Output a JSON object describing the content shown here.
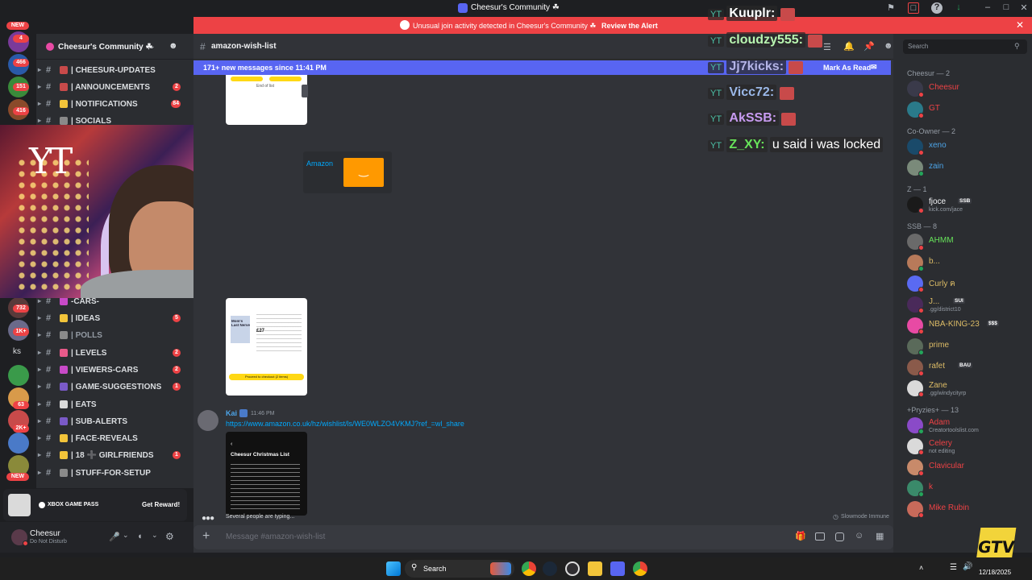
{
  "window": {
    "title": "Cheesur's Community ☘"
  },
  "alert": {
    "text": "Unusual join activity detected in Cheesur's Community ☘",
    "action": "Review the Alert"
  },
  "rail": {
    "new_top": "NEW",
    "new_bottom": "NEW",
    "badges": [
      "4",
      "466",
      "151",
      "416",
      "732",
      "1K+",
      "63",
      "2K+"
    ],
    "ks_label": "ks"
  },
  "server": {
    "name": "Cheesur's Community ☘"
  },
  "channels": [
    {
      "label": "| CHEESUR-UPDATES",
      "badge": "",
      "bold": true
    },
    {
      "label": "| ANNOUNCEMENTS",
      "badge": "2",
      "bold": true
    },
    {
      "label": "| NOTIFICATIONS",
      "badge": "84",
      "bold": true
    },
    {
      "label": "| SOCIALS",
      "badge": "",
      "bold": true
    },
    {
      "label": "-CARS-",
      "badge": "",
      "bold": true
    },
    {
      "label": "| IDEAS",
      "badge": "5",
      "bold": true
    },
    {
      "label": "| POLLS",
      "badge": "",
      "bold": false
    },
    {
      "label": "| LEVELS",
      "badge": "2",
      "bold": true
    },
    {
      "label": "| VIEWERS-CARS",
      "badge": "2",
      "bold": true
    },
    {
      "label": "| GAME-SUGGESTIONS",
      "badge": "1",
      "bold": true
    },
    {
      "label": "| EATS",
      "badge": "",
      "bold": true
    },
    {
      "label": "| SUB-ALERTS",
      "badge": "",
      "bold": true
    },
    {
      "label": "| FACE-REVEALS",
      "badge": "",
      "bold": true
    },
    {
      "label": "| 18 ➕ GIRLFRIENDS",
      "badge": "1",
      "bold": true
    },
    {
      "label": "| STUFF-FOR-SETUP",
      "badge": "",
      "bold": true
    }
  ],
  "promo": {
    "brand": "XBOX GAME PASS",
    "button": "Get Reward!"
  },
  "user": {
    "name": "Cheesur",
    "status": "Do Not Disturb"
  },
  "chat": {
    "channel": "amazon-wish-list",
    "new_messages": "171+ new messages since 11:41 PM",
    "mark_read": "Mark As Read",
    "embed_provider": "Amazon",
    "message": {
      "author": "Kai",
      "time": "11:46 PM",
      "link": "https://www.amazon.co.uk/hz/wishlist/ls/WE0WLZO4VKMJ?ref_=wl_share",
      "image_title": "Cheesur Christmas List"
    },
    "img1": {
      "line1": "End of list"
    },
    "img2": {
      "title": "Mom's Last Nerve",
      "price": "£27",
      "cta": "Proceed to checkout (2 items)"
    },
    "typing": "Several people are typing...",
    "slowmode": "Slowmode Immune",
    "placeholder": "Message #amazon-wish-list"
  },
  "overlay": [
    {
      "name": "Kuuplr:",
      "color": "#ffffff",
      "text": ""
    },
    {
      "name": "cloudzy555:",
      "color": "#b8f5b0",
      "text": ""
    },
    {
      "name": "Jj7kicks:",
      "color": "#b4b4e6",
      "text": ""
    },
    {
      "name": "Vicc72:",
      "color": "#9bb8e8",
      "text": ""
    },
    {
      "name": "AkSSB:",
      "color": "#c89bf0",
      "text": ""
    },
    {
      "name": "Z_XY:",
      "color": "#67e35a",
      "text": "u said i was locked"
    }
  ],
  "search": {
    "placeholder": "Search"
  },
  "members": {
    "groups": [
      {
        "title": "Cheesur — 2",
        "items": [
          {
            "name": "Cheesur",
            "color": "#ed4245",
            "sub": "",
            "tag": "",
            "status": "#ed4245",
            "av": "#3a3a4a"
          },
          {
            "name": "GT",
            "color": "#ed4245",
            "sub": "",
            "tag": "",
            "status": "#ed4245",
            "av": "#2a7a8a"
          }
        ]
      },
      {
        "title": "Co-Owner — 2",
        "items": [
          {
            "name": "xeno",
            "color": "#4ca4e8",
            "sub": "",
            "tag": "",
            "status": "#ed4245",
            "av": "#1a4a6a"
          },
          {
            "name": "zain",
            "color": "#4ca4e8",
            "sub": "",
            "tag": "",
            "status": "#23a55a",
            "av": "#7a8a7a"
          }
        ]
      },
      {
        "title": "Z — 1",
        "items": [
          {
            "name": "fjoce",
            "color": "#f2f3f5",
            "sub": "kick.com/jace",
            "tag": "SSB",
            "status": "#ed4245",
            "av": "#1a1a1a"
          }
        ]
      },
      {
        "title": "SSB — 8",
        "items": [
          {
            "name": "AHMM",
            "color": "#67e35a",
            "sub": "",
            "tag": "",
            "status": "#ed4245",
            "av": "#6a6a6a"
          },
          {
            "name": "b...",
            "color": "#ddbc66",
            "sub": "",
            "tag": "",
            "status": "#23a55a",
            "av": "#b87a5a"
          },
          {
            "name": "Curly ฅ",
            "color": "#ddbc66",
            "sub": "",
            "tag": "",
            "status": "#ed4245",
            "av": "#5a6af2"
          },
          {
            "name": "J...",
            "color": "#ddbc66",
            "sub": ".gg/district10",
            "tag": "SUI",
            "status": "#ed4245",
            "av": "#4a2a5a"
          },
          {
            "name": "NBA-KING-23",
            "color": "#ddbc66",
            "sub": "",
            "tag": "$$$",
            "status": "#ed4245",
            "av": "#e84aa4"
          },
          {
            "name": "prime",
            "color": "#ddbc66",
            "sub": "",
            "tag": "",
            "status": "#23a55a",
            "av": "#5a6a5a"
          },
          {
            "name": "rafet",
            "color": "#ddbc66",
            "sub": "",
            "tag": "BAU",
            "status": "#ed4245",
            "av": "#8a5a4a"
          },
          {
            "name": "Zane",
            "color": "#ddbc66",
            "sub": ".gg/windycityrp",
            "tag": "",
            "status": "#ed4245",
            "av": "#dadada"
          }
        ]
      },
      {
        "title": "+Pryzies+ — 13",
        "items": [
          {
            "name": "Adam",
            "color": "#ed4245",
            "sub": "Creatortoolslist.com",
            "tag": "",
            "status": "#23a55a",
            "av": "#8a4ac8"
          },
          {
            "name": "Celery",
            "color": "#ed4245",
            "sub": "not editing",
            "tag": "",
            "status": "#ed4245",
            "av": "#dadada"
          },
          {
            "name": "Clavicular",
            "color": "#ed4245",
            "sub": "",
            "tag": "",
            "status": "#ed4245",
            "av": "#c88a6a"
          },
          {
            "name": "k",
            "color": "#ed4245",
            "sub": "",
            "tag": "",
            "status": "#23a55a",
            "av": "#3a8a6a"
          },
          {
            "name": "Mike Rubin",
            "color": "#ed4245",
            "sub": "",
            "tag": "",
            "status": "#ed4245",
            "av": "#c86a5a"
          }
        ]
      }
    ]
  },
  "taskbar": {
    "search": "Search",
    "date": "12/18/2025"
  },
  "watermark": "GTV",
  "colors": {
    "accent": "#5865f2",
    "alert": "#ed4245",
    "link": "#00a8fc",
    "amazon": "#ff9900"
  }
}
